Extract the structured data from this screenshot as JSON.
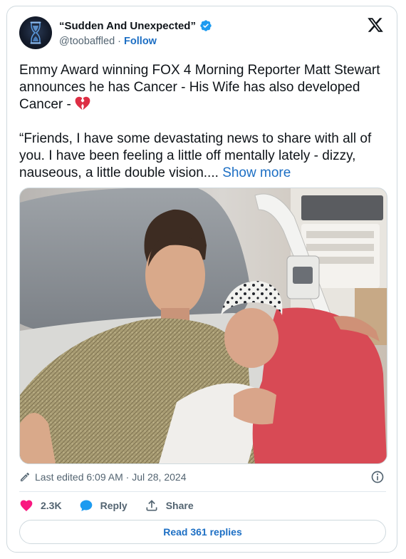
{
  "author": {
    "display_name": "“Sudden And Unexpected”",
    "handle": "@toobaffled",
    "separator": " · ",
    "follow_label": "Follow",
    "verified": true,
    "verified_color": "#1d9bf0"
  },
  "tweet": {
    "paragraph1": "Emmy Award winning FOX 4 Morning Reporter  Matt Stewart announces he has Cancer - His Wife has also developed Cancer - ",
    "paragraph1_emoji": "broken-heart-icon",
    "paragraph2": "“Friends, I have some devastating news to share with all of you. I have been feeling a little off mentally lately - dizzy, nauseous, a little double vision.... ",
    "show_more_label": "Show more"
  },
  "meta": {
    "edited_text": "Last edited 6:09 AM · Jul 28, 2024"
  },
  "actions": {
    "likes": "2.3K",
    "reply_label": "Reply",
    "share_label": "Share",
    "like_color": "#f91880",
    "reply_color": "#1d9bf0"
  },
  "replies_button": {
    "label": "Read 361 replies"
  },
  "colors": {
    "link": "#1d6fc4",
    "secondary_text": "#536471",
    "border": "#cfd9de"
  }
}
